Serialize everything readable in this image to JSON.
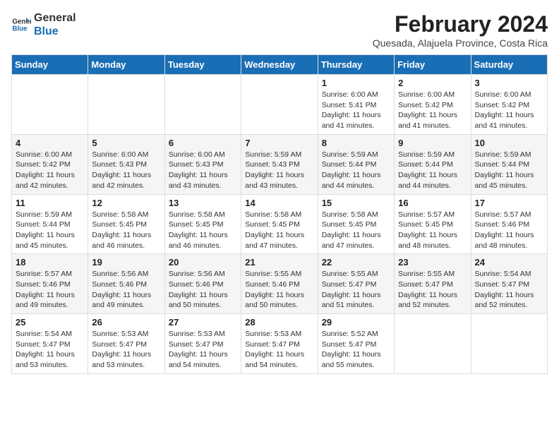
{
  "logo": {
    "line1": "General",
    "line2": "Blue"
  },
  "title": "February 2024",
  "subtitle": "Quesada, Alajuela Province, Costa Rica",
  "days_of_week": [
    "Sunday",
    "Monday",
    "Tuesday",
    "Wednesday",
    "Thursday",
    "Friday",
    "Saturday"
  ],
  "weeks": [
    [
      {
        "day": "",
        "info": ""
      },
      {
        "day": "",
        "info": ""
      },
      {
        "day": "",
        "info": ""
      },
      {
        "day": "",
        "info": ""
      },
      {
        "day": "1",
        "info": "Sunrise: 6:00 AM\nSunset: 5:41 PM\nDaylight: 11 hours and 41 minutes."
      },
      {
        "day": "2",
        "info": "Sunrise: 6:00 AM\nSunset: 5:42 PM\nDaylight: 11 hours and 41 minutes."
      },
      {
        "day": "3",
        "info": "Sunrise: 6:00 AM\nSunset: 5:42 PM\nDaylight: 11 hours and 41 minutes."
      }
    ],
    [
      {
        "day": "4",
        "info": "Sunrise: 6:00 AM\nSunset: 5:42 PM\nDaylight: 11 hours and 42 minutes."
      },
      {
        "day": "5",
        "info": "Sunrise: 6:00 AM\nSunset: 5:43 PM\nDaylight: 11 hours and 42 minutes."
      },
      {
        "day": "6",
        "info": "Sunrise: 6:00 AM\nSunset: 5:43 PM\nDaylight: 11 hours and 43 minutes."
      },
      {
        "day": "7",
        "info": "Sunrise: 5:59 AM\nSunset: 5:43 PM\nDaylight: 11 hours and 43 minutes."
      },
      {
        "day": "8",
        "info": "Sunrise: 5:59 AM\nSunset: 5:44 PM\nDaylight: 11 hours and 44 minutes."
      },
      {
        "day": "9",
        "info": "Sunrise: 5:59 AM\nSunset: 5:44 PM\nDaylight: 11 hours and 44 minutes."
      },
      {
        "day": "10",
        "info": "Sunrise: 5:59 AM\nSunset: 5:44 PM\nDaylight: 11 hours and 45 minutes."
      }
    ],
    [
      {
        "day": "11",
        "info": "Sunrise: 5:59 AM\nSunset: 5:44 PM\nDaylight: 11 hours and 45 minutes."
      },
      {
        "day": "12",
        "info": "Sunrise: 5:58 AM\nSunset: 5:45 PM\nDaylight: 11 hours and 46 minutes."
      },
      {
        "day": "13",
        "info": "Sunrise: 5:58 AM\nSunset: 5:45 PM\nDaylight: 11 hours and 46 minutes."
      },
      {
        "day": "14",
        "info": "Sunrise: 5:58 AM\nSunset: 5:45 PM\nDaylight: 11 hours and 47 minutes."
      },
      {
        "day": "15",
        "info": "Sunrise: 5:58 AM\nSunset: 5:45 PM\nDaylight: 11 hours and 47 minutes."
      },
      {
        "day": "16",
        "info": "Sunrise: 5:57 AM\nSunset: 5:45 PM\nDaylight: 11 hours and 48 minutes."
      },
      {
        "day": "17",
        "info": "Sunrise: 5:57 AM\nSunset: 5:46 PM\nDaylight: 11 hours and 48 minutes."
      }
    ],
    [
      {
        "day": "18",
        "info": "Sunrise: 5:57 AM\nSunset: 5:46 PM\nDaylight: 11 hours and 49 minutes."
      },
      {
        "day": "19",
        "info": "Sunrise: 5:56 AM\nSunset: 5:46 PM\nDaylight: 11 hours and 49 minutes."
      },
      {
        "day": "20",
        "info": "Sunrise: 5:56 AM\nSunset: 5:46 PM\nDaylight: 11 hours and 50 minutes."
      },
      {
        "day": "21",
        "info": "Sunrise: 5:55 AM\nSunset: 5:46 PM\nDaylight: 11 hours and 50 minutes."
      },
      {
        "day": "22",
        "info": "Sunrise: 5:55 AM\nSunset: 5:47 PM\nDaylight: 11 hours and 51 minutes."
      },
      {
        "day": "23",
        "info": "Sunrise: 5:55 AM\nSunset: 5:47 PM\nDaylight: 11 hours and 52 minutes."
      },
      {
        "day": "24",
        "info": "Sunrise: 5:54 AM\nSunset: 5:47 PM\nDaylight: 11 hours and 52 minutes."
      }
    ],
    [
      {
        "day": "25",
        "info": "Sunrise: 5:54 AM\nSunset: 5:47 PM\nDaylight: 11 hours and 53 minutes."
      },
      {
        "day": "26",
        "info": "Sunrise: 5:53 AM\nSunset: 5:47 PM\nDaylight: 11 hours and 53 minutes."
      },
      {
        "day": "27",
        "info": "Sunrise: 5:53 AM\nSunset: 5:47 PM\nDaylight: 11 hours and 54 minutes."
      },
      {
        "day": "28",
        "info": "Sunrise: 5:53 AM\nSunset: 5:47 PM\nDaylight: 11 hours and 54 minutes."
      },
      {
        "day": "29",
        "info": "Sunrise: 5:52 AM\nSunset: 5:47 PM\nDaylight: 11 hours and 55 minutes."
      },
      {
        "day": "",
        "info": ""
      },
      {
        "day": "",
        "info": ""
      }
    ]
  ]
}
